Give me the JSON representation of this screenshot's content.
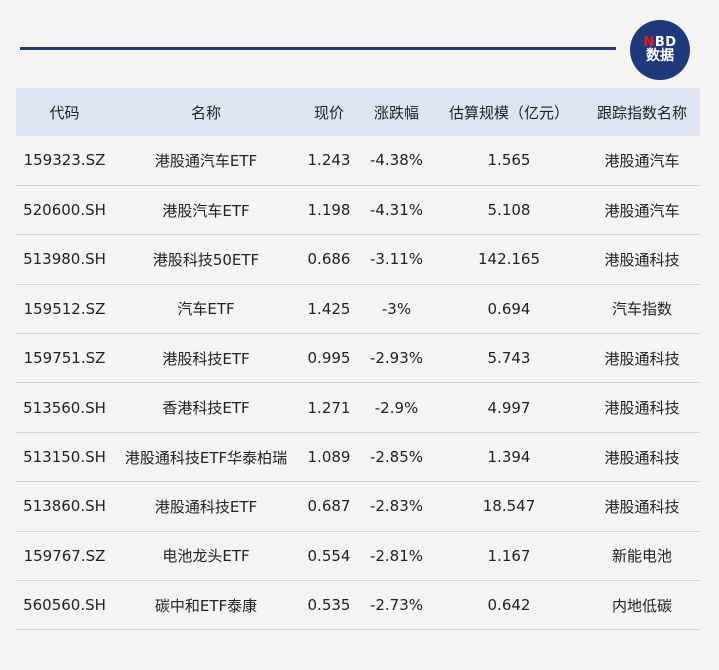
{
  "logo": {
    "line1_red": "N",
    "line1_rest": "BD",
    "line2": "数据"
  },
  "table": {
    "headers": [
      "代码",
      "名称",
      "现价",
      "涨跌幅",
      "估算规模（亿元）",
      "跟踪指数名称"
    ],
    "rows": [
      [
        "159323.SZ",
        "港股通汽车ETF",
        "1.243",
        "-4.38%",
        "1.565",
        "港股通汽车"
      ],
      [
        "520600.SH",
        "港股汽车ETF",
        "1.198",
        "-4.31%",
        "5.108",
        "港股通汽车"
      ],
      [
        "513980.SH",
        "港股科技50ETF",
        "0.686",
        "-3.11%",
        "142.165",
        "港股通科技"
      ],
      [
        "159512.SZ",
        "汽车ETF",
        "1.425",
        "-3%",
        "0.694",
        "汽车指数"
      ],
      [
        "159751.SZ",
        "港股科技ETF",
        "0.995",
        "-2.93%",
        "5.743",
        "港股通科技"
      ],
      [
        "513560.SH",
        "香港科技ETF",
        "1.271",
        "-2.9%",
        "4.997",
        "港股通科技"
      ],
      [
        "513150.SH",
        "港股通科技ETF华泰柏瑞",
        "1.089",
        "-2.85%",
        "1.394",
        "港股通科技"
      ],
      [
        "513860.SH",
        "港股通科技ETF",
        "0.687",
        "-2.83%",
        "18.547",
        "港股通科技"
      ],
      [
        "159767.SZ",
        "电池龙头ETF",
        "0.554",
        "-2.81%",
        "1.167",
        "新能电池"
      ],
      [
        "560560.SH",
        "碳中和ETF泰康",
        "0.535",
        "-2.73%",
        "0.642",
        "内地低碳"
      ]
    ]
  }
}
